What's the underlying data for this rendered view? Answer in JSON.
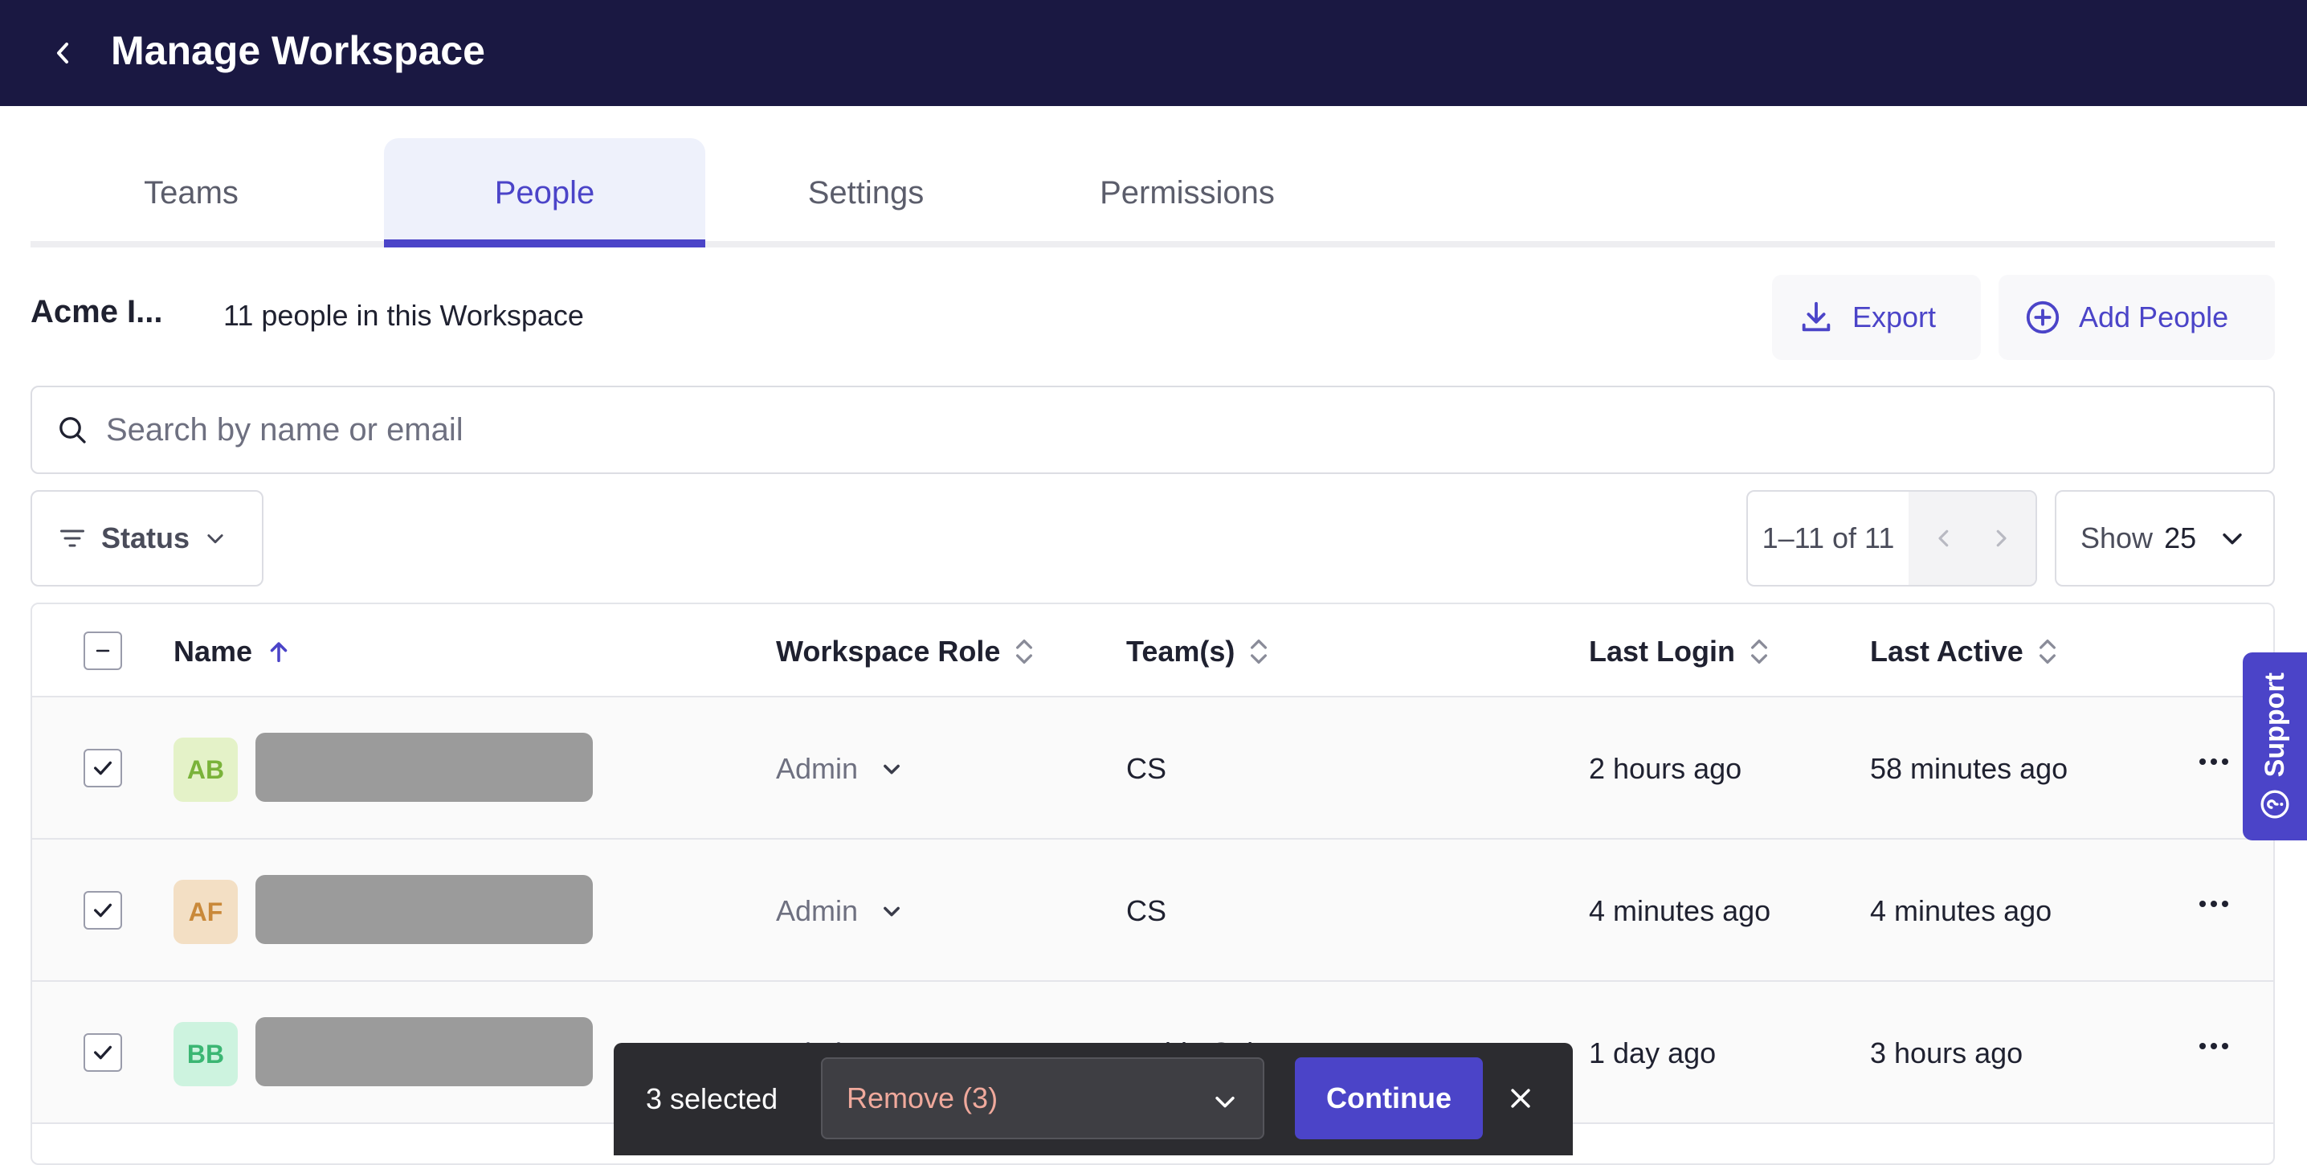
{
  "header": {
    "title": "Manage Workspace",
    "back_icon": "chevron-left-icon"
  },
  "tabs": [
    {
      "label": "Teams",
      "active": false
    },
    {
      "label": "People",
      "active": true
    },
    {
      "label": "Settings",
      "active": false
    },
    {
      "label": "Permissions",
      "active": false
    }
  ],
  "workspace": {
    "name": "Acme I...",
    "people_count": "11 people in this Workspace"
  },
  "actions": {
    "export_label": "Export",
    "add_people_label": "Add People"
  },
  "search": {
    "placeholder": "Search by name or email",
    "value": ""
  },
  "filters": {
    "status_label": "Status"
  },
  "pagination": {
    "range": "1–11 of 11",
    "show_label": "Show",
    "show_value": "25"
  },
  "table": {
    "columns": {
      "name": "Name",
      "role": "Workspace Role",
      "teams": "Team(s)",
      "last_login": "Last Login",
      "last_active": "Last Active"
    },
    "sort": {
      "column": "name",
      "direction": "ascending"
    },
    "rows": [
      {
        "initials": "AB",
        "selected": true,
        "role": "Admin",
        "teams": "CS",
        "last_login": "2 hours ago",
        "last_active": "58 minutes ago"
      },
      {
        "initials": "AF",
        "selected": true,
        "role": "Admin",
        "teams": "CS",
        "last_login": "4 minutes ago",
        "last_active": "4 minutes ago"
      },
      {
        "initials": "BB",
        "selected": true,
        "role": "Admin",
        "teams": "Inside Sales",
        "last_login": "1 day ago",
        "last_active": "3 hours ago"
      }
    ]
  },
  "support": {
    "label": "Support"
  },
  "bulk_bar": {
    "selected_text": "3 selected",
    "action_value": "Remove (3)",
    "continue_label": "Continue"
  },
  "colors": {
    "header_bg": "#1a1842",
    "accent": "#4b44c8",
    "bulk_bar_bg": "#2c2c30",
    "remove_text": "#f0a99c"
  }
}
